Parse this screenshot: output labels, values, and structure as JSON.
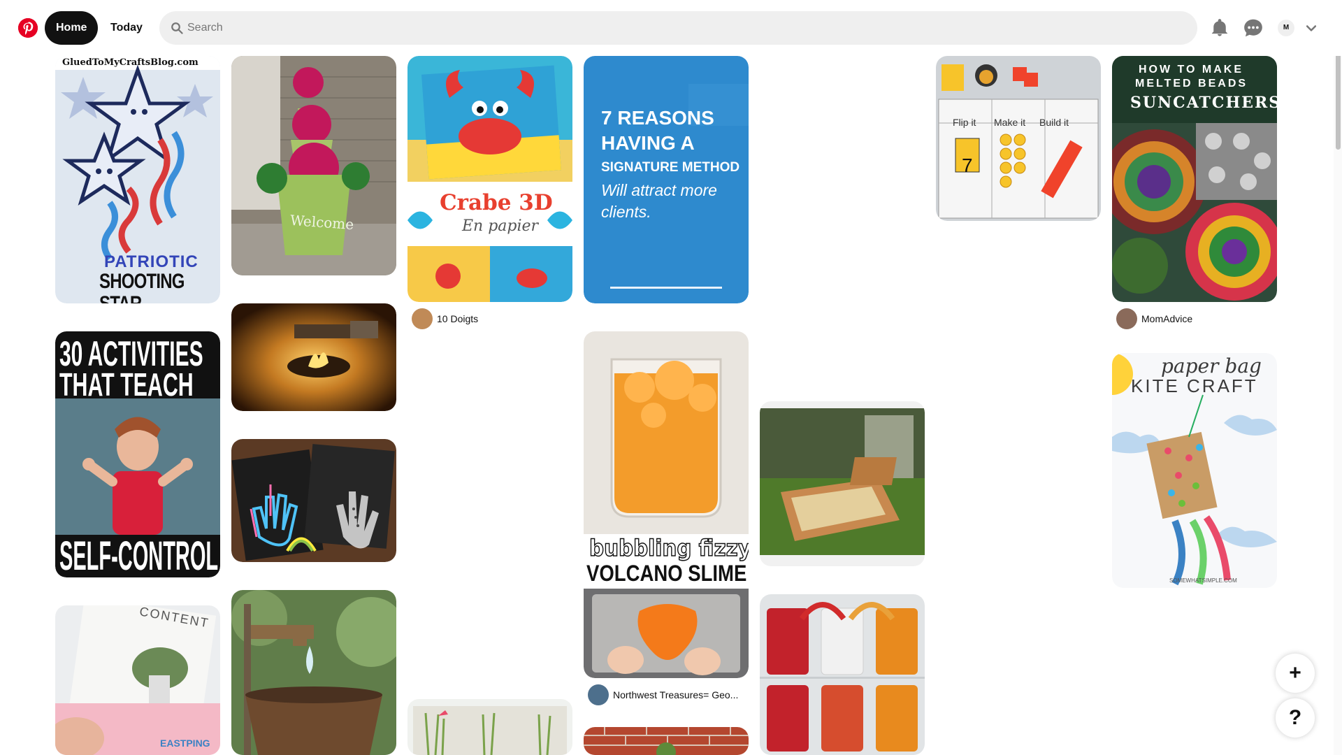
{
  "header": {
    "logo_icon": "pinterest-logo-icon",
    "home_label": "Home",
    "today_label": "Today",
    "search_placeholder": "Search",
    "notifications_icon": "bell-icon",
    "messages_icon": "chat-bubble-icon",
    "avatar_initial": "M",
    "accounts_icon": "chevron-down-icon",
    "brand_color": "#e60023"
  },
  "pins": {
    "patriotic": {
      "site": "GluedToMyCraftsBlog.com",
      "line1": "PATRIOTIC",
      "line2": "SHOOTING STAR"
    },
    "flowerpots": {
      "text": "Welcome"
    },
    "crab": {
      "title": "Crabe 3D",
      "subtitle": "En papier",
      "user": "10 Doigts"
    },
    "reasons": {
      "line1": "7 REASONS",
      "line2": "HAVING A",
      "line3": "SIGNATURE METHOD",
      "line4": "Will attract more",
      "line5": "clients."
    },
    "flip": {
      "col1": "Flip it",
      "col2": "Make it",
      "col3": "Build it",
      "number": "7"
    },
    "suncatchers": {
      "line1": "HOW TO MAKE",
      "line2": "MELTED BEADS",
      "line3": "SUNCATCHERS",
      "user": "MomAdvice"
    },
    "firepit": {},
    "activities": {
      "line1": "30 ACTIVITIES",
      "line2": "THAT TEACH",
      "line3": "SELF-CONTROL"
    },
    "handprint": {},
    "slime": {
      "line1": "bubbling fizzy",
      "line2": "VOLCANO SLIME",
      "user": "Northwest Treasures= Geo..."
    },
    "sandbox": {},
    "kite": {
      "line1": "paper bag",
      "line2": "KITE CRAFT",
      "site": "SOMEWHATSIMPLE.COM"
    },
    "magazine": {
      "title": "CONTENT",
      "brand": "EASTPING"
    },
    "faucet": {},
    "jars": {},
    "grass": {},
    "bricks": {}
  },
  "floating": {
    "create_label": "+",
    "help_label": "?"
  }
}
